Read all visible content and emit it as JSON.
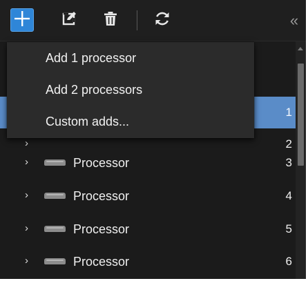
{
  "toolbar": {
    "buttons": [
      {
        "name": "add",
        "icon": "plus-icon"
      },
      {
        "name": "edit",
        "icon": "edit-icon"
      },
      {
        "name": "delete",
        "icon": "trash-icon"
      },
      {
        "name": "refresh",
        "icon": "refresh-icon"
      }
    ],
    "collapse_glyph": "«",
    "accent_color": "#2f86d8"
  },
  "add_menu": {
    "items": [
      {
        "label": "Add 1 processor"
      },
      {
        "label": "Add 2 processors"
      },
      {
        "label": "Custom adds..."
      }
    ]
  },
  "tree": {
    "selected_color": "#5a8cc8",
    "rows": [
      {
        "label": "",
        "number": "1",
        "selected": true,
        "expander": "›"
      },
      {
        "label": "",
        "number": "2",
        "selected": false,
        "expander": "›"
      },
      {
        "label": "Processor",
        "number": "3",
        "selected": false,
        "expander": "›"
      },
      {
        "label": "Processor",
        "number": "4",
        "selected": false,
        "expander": "›"
      },
      {
        "label": "Processor",
        "number": "5",
        "selected": false,
        "expander": "›"
      },
      {
        "label": "Processor",
        "number": "6",
        "selected": false,
        "expander": "›"
      }
    ]
  }
}
